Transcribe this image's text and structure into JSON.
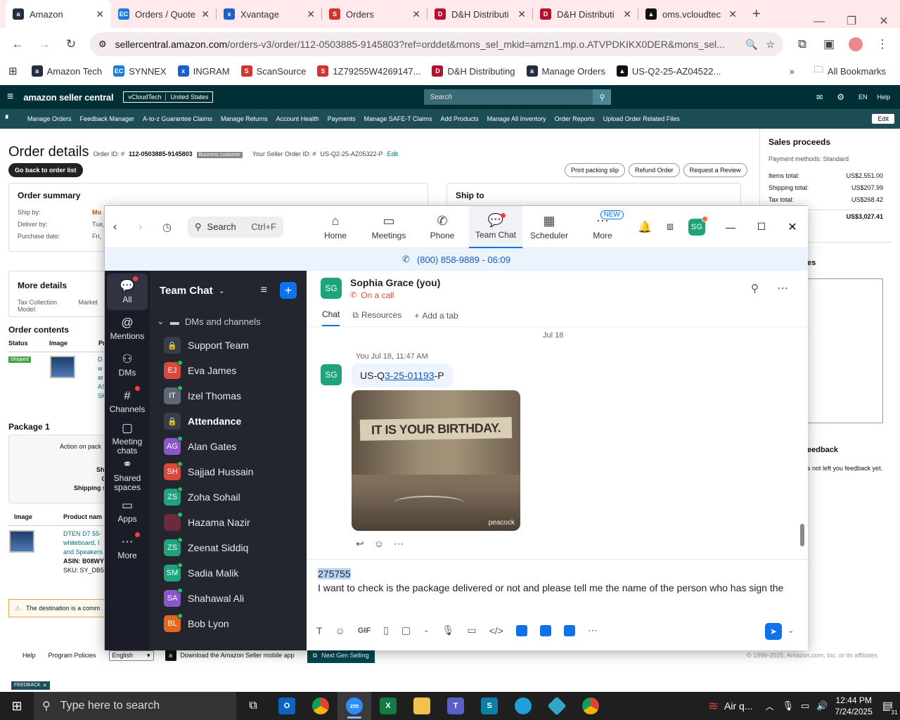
{
  "browser": {
    "tabs": [
      {
        "title": "Amazon",
        "icon_letter": "a",
        "color": "#232f3e",
        "active": true
      },
      {
        "title": "Orders / Quote",
        "icon_letter": "EC",
        "color": "#1a7ed8",
        "active": false
      },
      {
        "title": "Xvantage",
        "icon_letter": "x",
        "color": "#1b5fcc",
        "active": false
      },
      {
        "title": "Orders",
        "icon_letter": "S",
        "color": "#d0342c",
        "active": false
      },
      {
        "title": "D&H Distributi",
        "icon_letter": "D",
        "color": "#b3112d",
        "active": false
      },
      {
        "title": "D&H Distributi",
        "icon_letter": "D",
        "color": "#b3112d",
        "active": false
      },
      {
        "title": "oms.vcloudtec",
        "icon_letter": "▲",
        "color": "#111111",
        "active": false
      }
    ],
    "url_domain": "sellercentral.amazon.com",
    "url_path": "/orders-v3/order/112-0503885-9145803?ref=orddet&mons_sel_mkid=amzn1.mp.o.ATVPDKIKX0DER&mons_sel...",
    "bookmarks": [
      {
        "label": "Amazon Tech",
        "letter": "a",
        "color": "#232f3e"
      },
      {
        "label": "SYNNEX",
        "letter": "EC",
        "color": "#1a7ed8"
      },
      {
        "label": "INGRAM",
        "letter": "x",
        "color": "#1b5fcc"
      },
      {
        "label": "ScanSource",
        "letter": "S",
        "color": "#d0342c"
      },
      {
        "label": "1Z79255W4269147...",
        "letter": "S",
        "color": "#d0342c"
      },
      {
        "label": "D&H Distributing",
        "letter": "D",
        "color": "#b3112d"
      },
      {
        "label": "Manage Orders",
        "letter": "a",
        "color": "#232f3e"
      },
      {
        "label": "US-Q2-25-AZ04522...",
        "letter": "▲",
        "color": "#111111"
      }
    ],
    "all_bookmarks": "All Bookmarks"
  },
  "amazon": {
    "logo": "amazon seller central",
    "store": "vCloudTech",
    "marketplace": "United States",
    "search_placeholder": "Search",
    "lang": "EN",
    "help": "Help",
    "nav": [
      "Manage Orders",
      "Feedback Manager",
      "A-to-z Guarantee Claims",
      "Manage Returns",
      "Account Health",
      "Payments",
      "Manage SAFE-T Claims",
      "Add Products",
      "Manage All Inventory",
      "Order Reports",
      "Upload Order Related Files"
    ],
    "edit": "Edit",
    "page_title": "Order details",
    "order_id_label": "Order ID: #",
    "order_id": "112-0503885-9145803",
    "business_badge": "Business customer",
    "seller_order_label": "Your Seller Order ID: #",
    "seller_order_id": "US-Q2-25-AZ05322-P",
    "seller_order_edit": "Edit",
    "go_back": "Go back to order list",
    "actions": [
      "Print packing slip",
      "Refund Order",
      "Request a Review"
    ],
    "order_summary": "Order summary",
    "summary_labels": [
      "Ship by:",
      "Deliver by:",
      "Purchase date:"
    ],
    "summary_values": [
      "Mo",
      "Tue,",
      "Fri,"
    ],
    "ship_to": "Ship to",
    "more_details": "More details",
    "tax_model": "Tax Collection Model:",
    "tax_value": "Market",
    "order_contents": "Order contents",
    "oc_headers": [
      "Status",
      "Image",
      "Pr"
    ],
    "shipped": "Shipped",
    "oc_desc": [
      "D",
      "w",
      "ar",
      "AS",
      "SK"
    ],
    "package1": "Package 1",
    "action_on_pack": "Action on pack",
    "ship_lines": [
      "Shi",
      "C",
      "Shipping s"
    ],
    "pkg_headers": [
      "Image",
      "Product nam"
    ],
    "product_lines": [
      "DTEN D7 55-",
      "whiteboard, I",
      "and Speakers"
    ],
    "asin": "ASIN: B08WY",
    "sku": "SKU: SY_DB5",
    "warning": "The destination is a comm",
    "sales_proceeds": "Sales proceeds",
    "payment_methods": "Payment methods: Standard",
    "proceeds": [
      {
        "label": "Items total:",
        "value": "US$2,551.00"
      },
      {
        "label": "Shipping total:",
        "value": "US$207.99"
      },
      {
        "label": "Tax total:",
        "value": "US$268.42"
      }
    ],
    "grand_total": "US$3,027.41",
    "notes_label": "es",
    "feedback_title": "eedback",
    "feedback_text": "s not left you feedback yet.",
    "footer_help": "Help",
    "footer_policies": "Program Policies",
    "footer_lang": "English",
    "footer_app": "Download the Amazon Seller mobile app",
    "footer_next": "Next Gen Selling",
    "copyright": "© 1999-2025, Amazon.com, Inc. or its affiliates",
    "feedback_tag": "FEEDBACK"
  },
  "zoom": {
    "search_label": "Search",
    "search_shortcut": "Ctrl+F",
    "nav": [
      {
        "label": "Home",
        "icon": "home-icon",
        "glyph": "⌂"
      },
      {
        "label": "Meetings",
        "icon": "video-icon",
        "glyph": "▭"
      },
      {
        "label": "Phone",
        "icon": "phone-icon",
        "glyph": "✆"
      },
      {
        "label": "Team Chat",
        "icon": "chat-icon",
        "glyph": "💬"
      },
      {
        "label": "Scheduler",
        "icon": "calendar-icon",
        "glyph": "▦"
      },
      {
        "label": "More",
        "icon": "more-icon",
        "glyph": "⋯"
      }
    ],
    "new_badge": "NEW",
    "avatar": "SG",
    "call_banner": "(800) 858-9889 - 06:09",
    "rail": [
      {
        "label": "All",
        "glyph": "💬",
        "dot": true
      },
      {
        "label": "Mentions",
        "glyph": "@",
        "dot": false
      },
      {
        "label": "DMs",
        "glyph": "⚇",
        "dot": false
      },
      {
        "label": "Channels",
        "glyph": "#",
        "dot": true
      },
      {
        "label": "Meeting chats",
        "glyph": "▢",
        "dot": false
      },
      {
        "label": "Shared spaces",
        "glyph": "⚭",
        "dot": false
      },
      {
        "label": "Apps",
        "glyph": "▭",
        "dot": false
      },
      {
        "label": "More",
        "glyph": "⋯",
        "dot": true
      }
    ],
    "list_title": "Team Chat",
    "section": "DMs and channels",
    "contacts": [
      {
        "name": "Support Team",
        "initials": "🔒",
        "color": "#3a3d48",
        "bold": false
      },
      {
        "name": "Eva James",
        "initials": "EJ",
        "color": "#d9493b",
        "bold": false
      },
      {
        "name": "Izel Thomas",
        "initials": "IT",
        "color": "#5f6675",
        "bold": false
      },
      {
        "name": "Attendance",
        "initials": "🔒",
        "color": "#3a3d48",
        "bold": true
      },
      {
        "name": "Alan Gates",
        "initials": "AG",
        "color": "#8a56c9",
        "bold": false
      },
      {
        "name": "Sajjad Hussain",
        "initials": "SH",
        "color": "#d9493b",
        "bold": false
      },
      {
        "name": "Zoha Sohail",
        "initials": "ZS",
        "color": "#1fa37a",
        "bold": false
      },
      {
        "name": "Hazama Nazir",
        "initials": "",
        "color": "#6b2b3a",
        "bold": false
      },
      {
        "name": "Zeenat Siddiq",
        "initials": "ZS",
        "color": "#1fa37a",
        "bold": false
      },
      {
        "name": "Sadia Malik",
        "initials": "SM",
        "color": "#1fa37a",
        "bold": false
      },
      {
        "name": "Shahawal Ali",
        "initials": "SA",
        "color": "#8a56c9",
        "bold": false
      },
      {
        "name": "Bob Lyon",
        "initials": "BL",
        "color": "#e2681e",
        "bold": false
      }
    ],
    "chat_name": "Sophia Grace (you)",
    "chat_status": "On a call",
    "tabs": [
      "Chat",
      "Resources",
      "Add a tab"
    ],
    "date_divider": "Jul 18",
    "msg_meta": "You Jul 18, 11:47 AM",
    "msg_prefix": "US-Q",
    "msg_link": "3-25-01193",
    "msg_suffix": "-P",
    "gif_text": "IT IS YOUR BIRTHDAY.",
    "gif_brand": "peacock",
    "compose_selected": "275755",
    "compose_text": "I want to check is the package delivered or not and please tell me the name of the person who has sign the"
  },
  "taskbar": {
    "search_placeholder": "Type here to search",
    "weather": "Air q...",
    "time": "12:44 PM",
    "date": "7/24/2025",
    "notifications": "31"
  }
}
